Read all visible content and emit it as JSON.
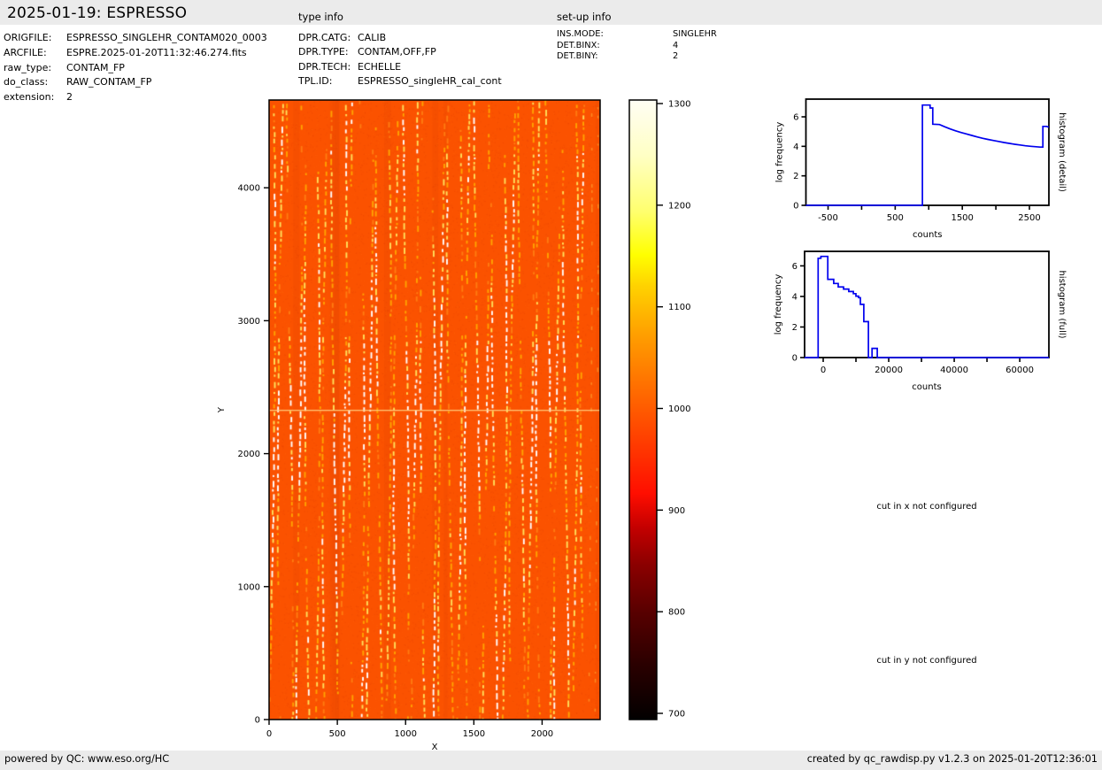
{
  "header": {
    "title": "2025-01-19: ESPRESSO",
    "type_info_label": "type info",
    "setup_info_label": "set-up info"
  },
  "metadata": {
    "rows": [
      {
        "label": "ORIGFILE:",
        "value": "ESPRESSO_SINGLEHR_CONTAM020_0003"
      },
      {
        "label": "ARCFILE:",
        "value": "ESPRE.2025-01-20T11:32:46.274.fits"
      },
      {
        "label": "raw_type:",
        "value": "CONTAM_FP"
      },
      {
        "label": "do_class:",
        "value": "RAW_CONTAM_FP"
      },
      {
        "label": "extension:",
        "value": "2"
      }
    ]
  },
  "type_info": {
    "rows": [
      {
        "label": "DPR.CATG:",
        "value": "CALIB"
      },
      {
        "label": "DPR.TYPE:",
        "value": "CONTAM,OFF,FP"
      },
      {
        "label": "DPR.TECH:",
        "value": "ECHELLE"
      },
      {
        "label": "TPL.ID:",
        "value": "ESPRESSO_singleHR_cal_cont"
      }
    ]
  },
  "setup_info": {
    "rows": [
      {
        "label": "INS.MODE:",
        "value": "SINGLEHR"
      },
      {
        "label": "DET.BINX:",
        "value": "4"
      },
      {
        "label": "DET.BINY:",
        "value": "2"
      }
    ]
  },
  "notes": {
    "cut_x": "cut in x not configured",
    "cut_y": "cut in y not configured"
  },
  "footer": {
    "left": "powered by QC: www.eso.org/HC",
    "right": "created by qc_rawdisp.py v1.2.3 on 2025-01-20T12:36:01"
  },
  "chart_data": [
    {
      "type": "heatmap",
      "id": "raw-image",
      "description": "ESPRESSO raw echelle Fabry-Perot contamination frame: orange background near 1000 counts with ~36 near-vertical dashed bright fringe columns (yellow/white), brighter continuous segments in the middle rows, a faint light horizontal line near Y=2330, plain right margin",
      "xlabel": "X",
      "ylabel": "Y",
      "xlim": [
        0,
        2425
      ],
      "ylim": [
        0,
        4660
      ],
      "x_ticks": [
        0,
        500,
        1000,
        1500,
        2000
      ],
      "y_ticks": [
        0,
        1000,
        2000,
        3000,
        4000
      ],
      "colormap": "hot",
      "background_counts": 1000,
      "colorbar": {
        "lim": [
          700,
          1300
        ],
        "ticks": [
          700,
          800,
          900,
          1000,
          1100,
          1200,
          1300
        ]
      },
      "pattern": {
        "bg_color": "#fb5200",
        "stripe_count": 36,
        "dash_colors": [
          "#ffffff",
          "#ffe05a",
          "#ffa300"
        ],
        "horizontal_line_y": 2330
      }
    },
    {
      "type": "line",
      "id": "histogram-detail",
      "right_label": "histogram (detail)",
      "xlabel": "counts",
      "ylabel": "log frequency",
      "color": "#0000ee",
      "xlim": [
        -830,
        2790
      ],
      "ylim": [
        0,
        7.2
      ],
      "x_ticks": [
        -500,
        500,
        1500,
        2500
      ],
      "x_minor_ticks": [
        0,
        1000,
        2000
      ],
      "y_ticks": [
        0,
        2,
        4,
        6
      ],
      "points": [
        [
          -830,
          0
        ],
        [
          905,
          0
        ],
        [
          905,
          6.8
        ],
        [
          1020,
          6.8
        ],
        [
          1020,
          6.6
        ],
        [
          1060,
          6.6
        ],
        [
          1060,
          5.5
        ],
        [
          1160,
          5.48
        ],
        [
          1240,
          5.32
        ],
        [
          1320,
          5.18
        ],
        [
          1400,
          5.05
        ],
        [
          1480,
          4.94
        ],
        [
          1560,
          4.84
        ],
        [
          1640,
          4.74
        ],
        [
          1720,
          4.64
        ],
        [
          1800,
          4.55
        ],
        [
          1880,
          4.47
        ],
        [
          1960,
          4.4
        ],
        [
          2040,
          4.33
        ],
        [
          2120,
          4.26
        ],
        [
          2200,
          4.2
        ],
        [
          2280,
          4.14
        ],
        [
          2360,
          4.09
        ],
        [
          2440,
          4.04
        ],
        [
          2520,
          4.0
        ],
        [
          2600,
          3.97
        ],
        [
          2660,
          3.95
        ],
        [
          2700,
          3.95
        ],
        [
          2700,
          5.35
        ],
        [
          2755,
          5.35
        ],
        [
          2790,
          5.3
        ]
      ]
    },
    {
      "type": "line",
      "id": "histogram-full",
      "right_label": "histogram (full)",
      "xlabel": "counts",
      "ylabel": "log frequency",
      "color": "#0000ee",
      "xlim": [
        -5680,
        68900
      ],
      "ylim": [
        0,
        6.95
      ],
      "x_ticks": [
        0,
        20000,
        40000,
        60000
      ],
      "x_minor_ticks": [
        10000,
        30000,
        50000
      ],
      "y_ticks": [
        0,
        2,
        4,
        6
      ],
      "points": [
        [
          -5680,
          0
        ],
        [
          -1540,
          0
        ],
        [
          -1540,
          6.5
        ],
        [
          -700,
          6.5
        ],
        [
          -700,
          6.62
        ],
        [
          1400,
          6.62
        ],
        [
          1400,
          5.12
        ],
        [
          3200,
          5.12
        ],
        [
          3200,
          4.85
        ],
        [
          4600,
          4.85
        ],
        [
          4600,
          4.62
        ],
        [
          6200,
          4.62
        ],
        [
          6200,
          4.48
        ],
        [
          7800,
          4.48
        ],
        [
          7800,
          4.32
        ],
        [
          9200,
          4.32
        ],
        [
          9200,
          4.18
        ],
        [
          10000,
          4.18
        ],
        [
          10000,
          4.02
        ],
        [
          10800,
          4.02
        ],
        [
          10800,
          3.92
        ],
        [
          11350,
          3.92
        ],
        [
          11350,
          3.48
        ],
        [
          12400,
          3.48
        ],
        [
          12400,
          2.35
        ],
        [
          13800,
          2.35
        ],
        [
          13800,
          0
        ],
        [
          14900,
          0
        ],
        [
          14900,
          0.6
        ],
        [
          16500,
          0.6
        ],
        [
          16500,
          0
        ],
        [
          68900,
          0
        ]
      ]
    }
  ]
}
